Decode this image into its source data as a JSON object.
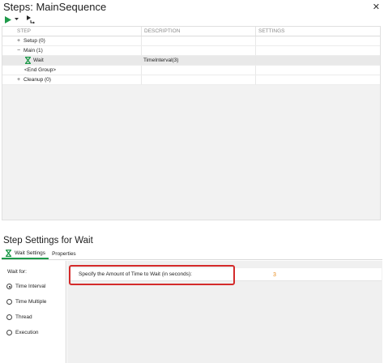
{
  "steps": {
    "title": "Steps: MainSequence",
    "columns": [
      "STEP",
      "DESCRIPTION",
      "SETTINGS"
    ],
    "rows": [
      {
        "expander": "+",
        "label": "Setup (0)",
        "description": "",
        "settings": ""
      },
      {
        "expander": "−",
        "label": "Main (1)",
        "description": "",
        "settings": ""
      },
      {
        "expander": "",
        "label": "Wait",
        "description": "TimeInterval(3)",
        "settings": ""
      },
      {
        "expander": "",
        "label": "<End Group>",
        "description": "",
        "settings": ""
      },
      {
        "expander": "+",
        "label": "Cleanup (0)",
        "description": "",
        "settings": ""
      }
    ]
  },
  "settings": {
    "title": "Step Settings for Wait",
    "tabs": [
      "Wait Settings",
      "Properties"
    ],
    "wait_for_label": "Wait for:",
    "options": [
      "Time Interval",
      "Time Multiple",
      "Thread",
      "Execution"
    ],
    "selected_option": "Time Interval",
    "time_label": "Specify the Amount of Time to Wait (in seconds):",
    "time_value": "3"
  },
  "colors": {
    "run_green": "#1e9a4a",
    "value_orange": "#e88a1a",
    "highlight_red": "#d42a2a"
  },
  "icons": [
    "close-icon",
    "run-icon",
    "dropdown-arrow-icon",
    "step-into-icon",
    "hourglass-icon"
  ]
}
